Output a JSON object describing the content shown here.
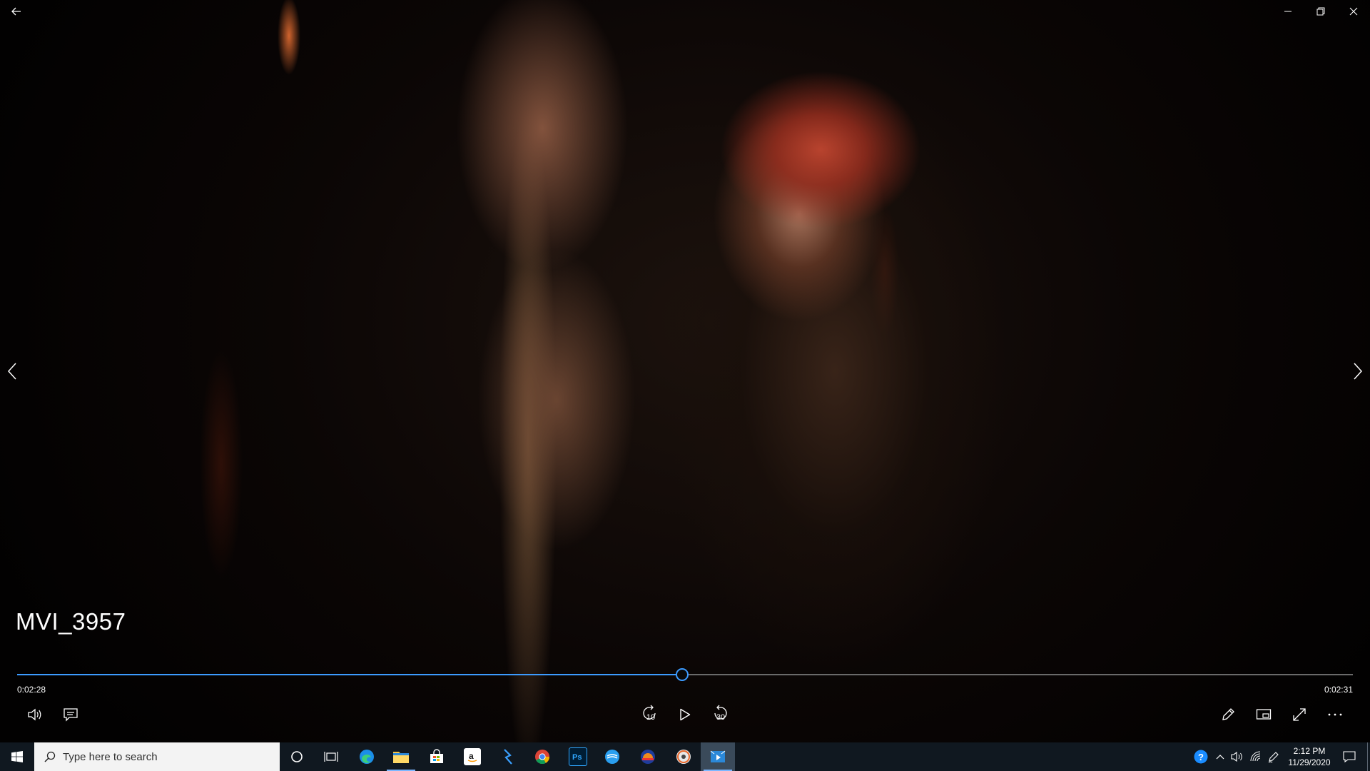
{
  "video": {
    "title": "MVI_3957",
    "current_time": "0:02:28",
    "total_time": "0:02:31",
    "progress_fraction": 0.498
  },
  "controls": {
    "skip_back_seconds": "10",
    "skip_forward_seconds": "30"
  },
  "taskbar": {
    "search_placeholder": "Type here to search",
    "clock_time": "2:12 PM",
    "clock_date": "11/29/2020"
  },
  "colors": {
    "accent": "#3c9bff",
    "taskbar_bg": "#101820"
  },
  "icons": {
    "back": "arrow-left",
    "minimize": "minimize",
    "restore": "restore",
    "close": "close",
    "prev": "chevron-left",
    "next": "chevron-right",
    "volume": "speaker",
    "captions": "speech-bubble",
    "play": "play-triangle",
    "edit": "pencil",
    "mini_view": "picture-in-picture",
    "fullscreen": "expand-arrows",
    "more": "ellipsis"
  }
}
